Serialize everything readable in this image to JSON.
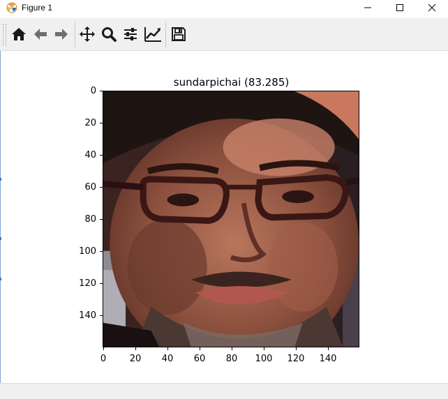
{
  "window": {
    "title": "Figure 1"
  },
  "toolbar": {
    "buttons": [
      {
        "name": "home-icon",
        "tooltip": "Home"
      },
      {
        "name": "back-icon",
        "tooltip": "Back"
      },
      {
        "name": "forward-icon",
        "tooltip": "Forward"
      },
      {
        "name": "pan-icon",
        "tooltip": "Pan"
      },
      {
        "name": "zoom-icon",
        "tooltip": "Zoom"
      },
      {
        "name": "subplots-icon",
        "tooltip": "Subplots"
      },
      {
        "name": "customize-icon",
        "tooltip": "Customize"
      },
      {
        "name": "save-icon",
        "tooltip": "Save"
      }
    ]
  },
  "plot": {
    "title": "sundarpichai (83.285)",
    "y_ticks": [
      "0",
      "20",
      "40",
      "60",
      "80",
      "100",
      "120",
      "140"
    ],
    "x_ticks": [
      "0",
      "20",
      "40",
      "60",
      "80",
      "100",
      "120",
      "140"
    ],
    "image_size": [
      160,
      160
    ]
  },
  "colors": {
    "window_bg": "#ffffff",
    "toolbar_bg": "#f0f0f0",
    "icon_color": "#1a1a1a"
  }
}
